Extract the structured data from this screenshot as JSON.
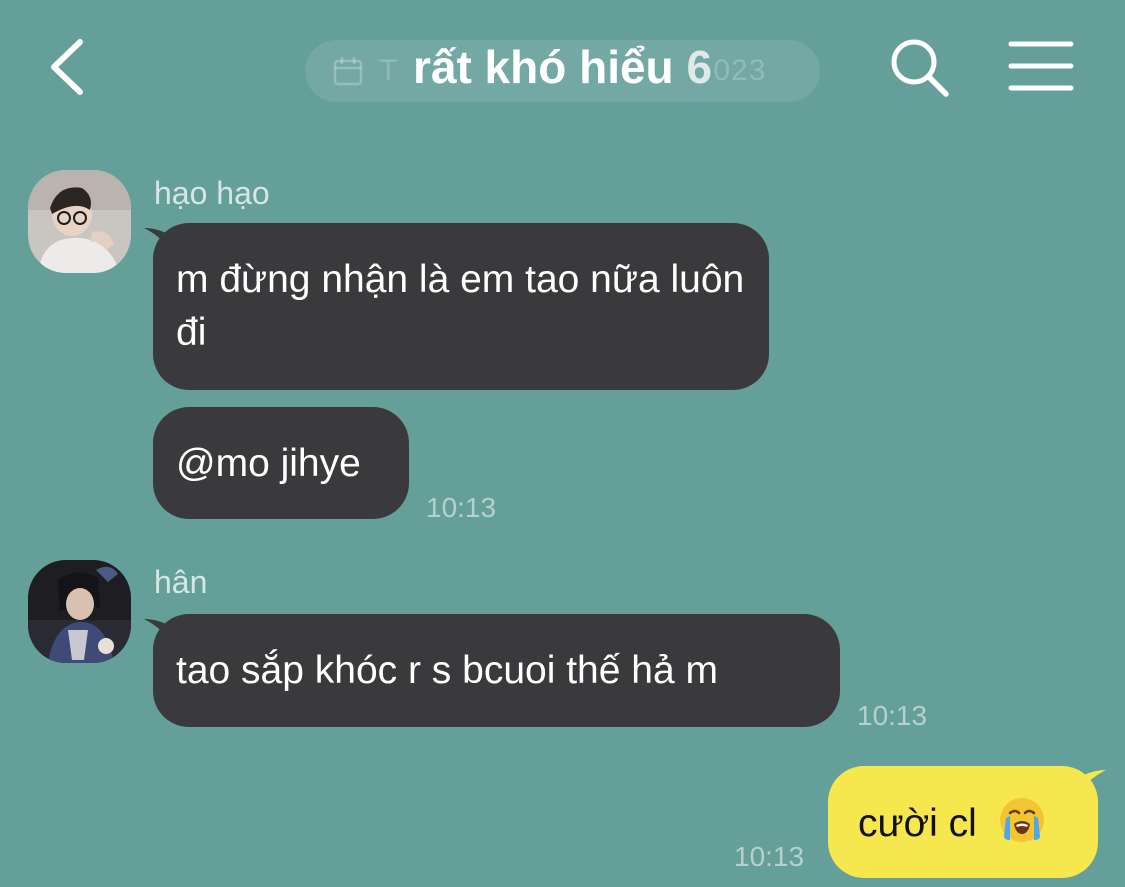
{
  "header": {
    "title": "rất khó hiểu",
    "member_count": "6",
    "date_prefix": "T",
    "date_suffix": "023"
  },
  "messages": {
    "m1": {
      "sender": "hạo hạo",
      "text": "m đừng nhận là em tao nữa luôn đi"
    },
    "m2": {
      "text": "@mo jihye",
      "time": "10:13"
    },
    "m3": {
      "sender": "hân",
      "text": "tao sắp khóc r s bcuoi thế hả m",
      "time": "10:13"
    },
    "m4": {
      "text": "cười cl",
      "time": "10:13",
      "emoji": "loudly-crying-face"
    }
  },
  "colors": {
    "background": "#649f9a",
    "incoming_bubble": "#3a3a3c",
    "outgoing_bubble": "#f6e74e",
    "timestamp": "#b7d0cd"
  }
}
